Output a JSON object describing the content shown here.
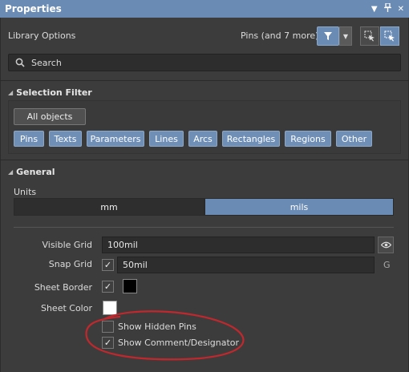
{
  "window": {
    "title": "Properties",
    "icons": [
      "dropdown-arrow-icon",
      "pin-icon",
      "close-icon"
    ]
  },
  "header": {
    "library_options": "Library Options",
    "pins_summary": "Pins (and 7 more)"
  },
  "search": {
    "placeholder": "Search"
  },
  "selection_filter": {
    "title": "Selection Filter",
    "all_objects": "All objects",
    "chips": [
      "Pins",
      "Texts",
      "Parameters",
      "Lines",
      "Arcs",
      "Rectangles",
      "Regions",
      "Other"
    ]
  },
  "general": {
    "title": "General",
    "units_label": "Units",
    "units_mm": "mm",
    "units_mils": "mils",
    "selected_unit": "mils",
    "visible_grid_label": "Visible Grid",
    "visible_grid_value": "100mil",
    "snap_grid_label": "Snap Grid",
    "snap_grid_value": "50mil",
    "snap_grid_shortcut": "G",
    "sheet_border_label": "Sheet Border",
    "sheet_color_label": "Sheet Color",
    "show_hidden_pins": "Show Hidden Pins",
    "show_comment_designator": "Show Comment/Designator",
    "snap_grid_checked": true,
    "sheet_border_checked": true,
    "show_hidden_pins_checked": false,
    "show_comment_designator_checked": true,
    "sheet_border_color": "#000000",
    "sheet_color": "#ffffff"
  },
  "colors": {
    "accent": "#6a8bb3",
    "annotation": "#c0282d"
  }
}
